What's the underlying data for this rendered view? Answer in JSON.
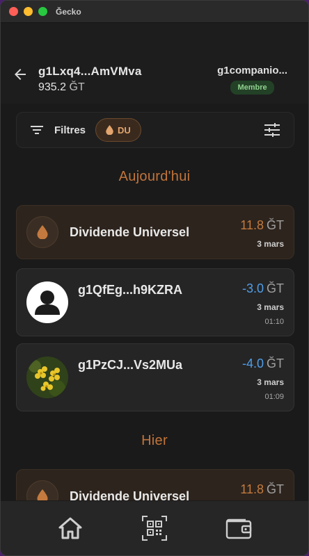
{
  "window": {
    "title": "Ğecko"
  },
  "header": {
    "address": "g1Lxq4...AmVMva",
    "balance": "935.2",
    "unit": "ĞT",
    "account_name": "g1companio...",
    "status_badge": "Membre"
  },
  "filters": {
    "label": "Filtres",
    "chip": "DU"
  },
  "sections": [
    {
      "label": "Aujourd'hui",
      "items": [
        {
          "type": "dividend",
          "title": "Dividende Universel",
          "amount": "11.8",
          "unit": "ĞT",
          "date": "3 mars"
        },
        {
          "type": "transfer",
          "title": "g1QfEg...h9KZRA",
          "amount": "-3.0",
          "unit": "ĞT",
          "date": "3 mars",
          "time": "01:10",
          "avatar": "person-icon"
        },
        {
          "type": "transfer",
          "title": "g1PzCJ...Vs2MUa",
          "amount": "-4.0",
          "unit": "ĞT",
          "date": "3 mars",
          "time": "01:09",
          "avatar": "flower-photo"
        }
      ]
    },
    {
      "label": "Hier",
      "items": [
        {
          "type": "dividend",
          "title": "Dividende Universel",
          "amount": "11.8",
          "unit": "ĞT"
        }
      ]
    }
  ],
  "bottom_nav": [
    {
      "name": "home-icon"
    },
    {
      "name": "qr-code-icon"
    },
    {
      "name": "wallet-icon"
    }
  ],
  "colors": {
    "accent_orange": "#c47a3e",
    "negative_blue": "#4f9de8",
    "member_green": "#8fd18f"
  }
}
